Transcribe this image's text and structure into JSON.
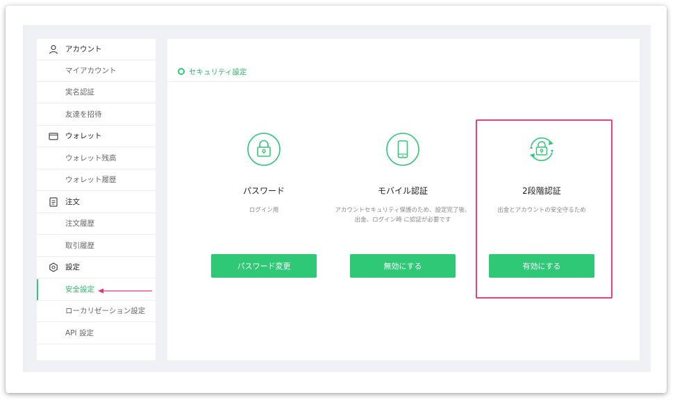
{
  "sidebar": {
    "sections": [
      {
        "label": "アカウント",
        "icon": "user-icon",
        "items": [
          "マイアカウント",
          "実名認証",
          "友達を招待"
        ]
      },
      {
        "label": "ウォレット",
        "icon": "wallet-icon",
        "items": [
          "ウォレット残高",
          "ウォレット履歴"
        ]
      },
      {
        "label": "注文",
        "icon": "document-icon",
        "items": [
          "注文履歴",
          "取引履歴"
        ]
      },
      {
        "label": "設定",
        "icon": "settings-icon",
        "items": [
          "安全設定",
          "ローカリゼーション設定",
          "API 設定"
        ]
      }
    ],
    "active_item": "安全設定"
  },
  "main": {
    "section_title": "セキュリティ設定",
    "cards": [
      {
        "title": "パスワード",
        "desc": "ログイン用",
        "button": "パスワード変更",
        "icon": "lock-icon"
      },
      {
        "title": "モバイル認証",
        "desc": "アカウントセキュリティ保護のため、設定完了後、出金、ログイン時 に認証が必要です",
        "button": "無効にする",
        "icon": "mobile-phone-icon"
      },
      {
        "title": "2段階認証",
        "desc": "出金とアカウントの安全守るため",
        "button": "有効にする",
        "icon": "lock-refresh-icon"
      }
    ]
  },
  "colors": {
    "accent": "#2ec876",
    "highlight": "#ee3d7c",
    "annotation_arrow": "#e8306f"
  }
}
